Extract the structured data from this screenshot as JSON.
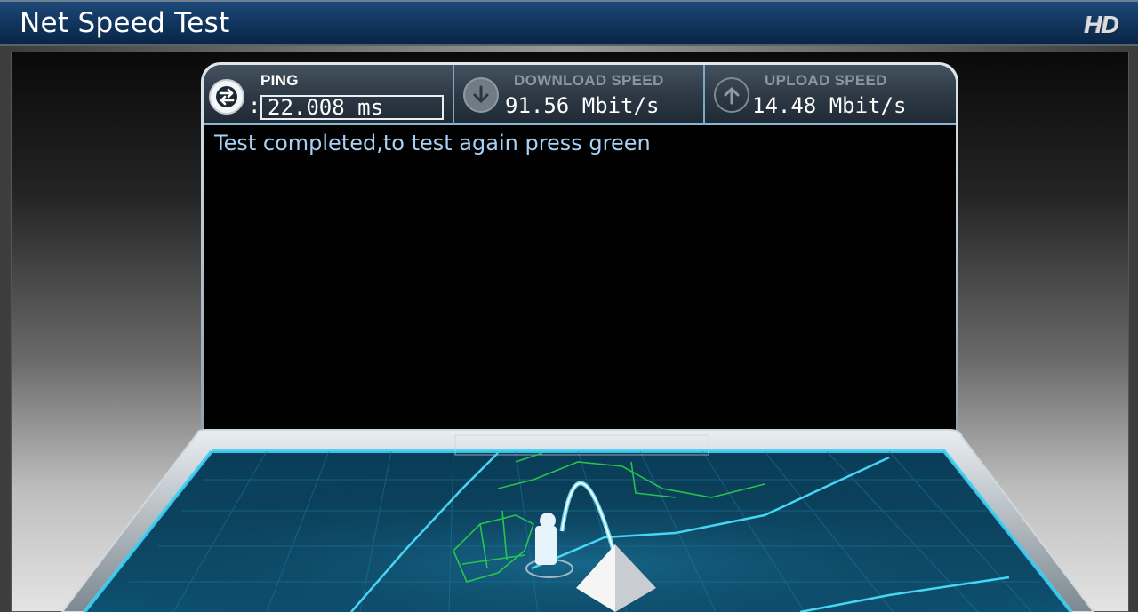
{
  "titlebar": {
    "title": "Net Speed Test",
    "badge": "HD"
  },
  "stats": {
    "ping": {
      "label": "PING",
      "separator": ":",
      "value": "22.008 ms",
      "icon": "ping-arrows-icon"
    },
    "download": {
      "label": "DOWNLOAD SPEED",
      "value": "91.56 Mbit/s",
      "icon": "arrow-down-icon"
    },
    "upload": {
      "label": "UPLOAD SPEED",
      "value": "14.48 Mbit/s",
      "icon": "arrow-up-icon"
    }
  },
  "status": {
    "message": "Test completed,to test again press green"
  },
  "colors": {
    "titlebar": "#123761",
    "accent_text": "#a9d1f5",
    "map_glow": "#39c6f0",
    "map_borders": "#2ad14a"
  },
  "map": {
    "icons": [
      "user-location-icon",
      "server-pyramid-icon"
    ]
  }
}
